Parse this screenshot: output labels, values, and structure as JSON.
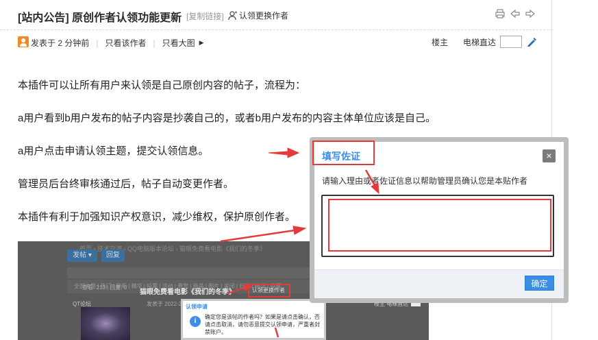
{
  "post": {
    "title": "[站内公告] 原创作者认领功能更新",
    "copy_link": "[复制链接]",
    "claim_link": "认领更换作者",
    "meta": {
      "posted": "发表于 2 分钟前",
      "only_author": "只看该作者",
      "only_images": "只看大图"
    },
    "floor_label": "楼主",
    "jump_label": "电梯直达",
    "paragraphs": [
      "本插件可以让所有用户来认领是自己原创内容的帖子，流程为：",
      "a用户看到b用户发布的帖子内容是抄袭自己的，或者b用户发布的内容主体单位应该是自己。",
      "a用户点击申请认领主题，提交认领信息。",
      "管理员后台终审核通过后，帖子自动变更作者。",
      "本插件有利于加强知识产权意识，减少维权，保护原创作者。"
    ]
  },
  "embedded": {
    "nav": "首页  ›  技术交流  ›  QQ电脑版本论坛  ›  猫眼免费看电影《我们的冬季》",
    "btn_post": "发帖 ▾",
    "btn_reply": "回复",
    "cats": "全部主题 | 热门 | 最新 | 精华 | 投票 | 活动 | 悬赏 | 商品 | 图片 | 关闭 | 归档 | 精华 | 投票",
    "left_meta": "查看: 213 | 回复: 0",
    "forum_name": "QT论坛",
    "post_title": "猫眼免费看电影《我们的冬季》",
    "claim": "认领更换作者",
    "sent": "发表于 2022-2-18",
    "floor": "楼主  电梯直达",
    "dialog_title": "认领申请",
    "dialog_text": "确定您是该帖的作者吗？如果是请点击确认，否请点击取消，请勿恶意提交认领申请，严重者封禁账户。"
  },
  "dialog": {
    "title": "填写佐证",
    "close": "×",
    "description": "请输入理由或者佐证信息以帮助管理员确认您是本贴作者",
    "reason_value": "",
    "ok_label": "确定"
  },
  "icons": {
    "claim": "user-icon",
    "print": "print-icon",
    "prev": "prev-arrow-icon",
    "next": "next-arrow-icon",
    "avatar": "avatar-icon",
    "jump": "jump-pen-icon",
    "info": "info-icon"
  },
  "colors": {
    "accent_blue": "#3a8ee6",
    "annotation_red": "#e53a3a",
    "avatar_orange": "#f08a24"
  }
}
